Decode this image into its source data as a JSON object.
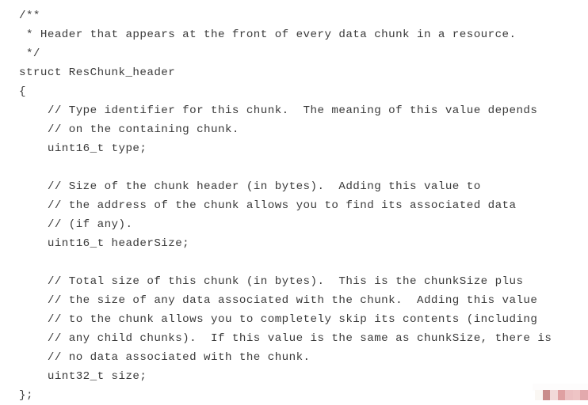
{
  "document": {
    "type": "source-code-listing",
    "language": "C",
    "background_color": "#ffffff",
    "text_color": "#3a3a3a",
    "lines": [
      "/**",
      " * Header that appears at the front of every data chunk in a resource.",
      " */",
      "struct ResChunk_header",
      "{",
      "    // Type identifier for this chunk.  The meaning of this value depends",
      "    // on the containing chunk.",
      "    uint16_t type;",
      "",
      "    // Size of the chunk header (in bytes).  Adding this value to",
      "    // the address of the chunk allows you to find its associated data",
      "    // (if any).",
      "    uint16_t headerSize;",
      "",
      "    // Total size of this chunk (in bytes).  This is the chunkSize plus",
      "    // the size of any data associated with the chunk.  Adding this value",
      "    // to the chunk allows you to completely skip its contents (including",
      "    // any child chunks).  If this value is the same as chunkSize, there is",
      "    // no data associated with the chunk.",
      "    uint32_t size;",
      "};"
    ]
  },
  "color_strip": {
    "label": "scan-color-calibration-strip",
    "swatches": [
      "#faf7f3",
      "#c98d8b",
      "#f2d9d9",
      "#dfa0a2",
      "#ecc0c2",
      "#eec4c5",
      "#e3a9ad"
    ]
  }
}
